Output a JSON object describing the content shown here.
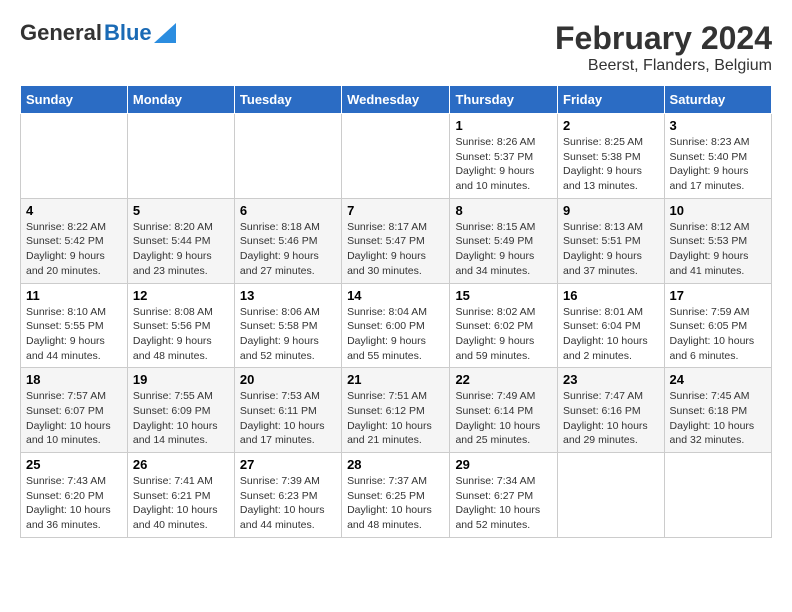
{
  "logo": {
    "part1": "General",
    "part2": "Blue"
  },
  "title": "February 2024",
  "subtitle": "Beerst, Flanders, Belgium",
  "days_of_week": [
    "Sunday",
    "Monday",
    "Tuesday",
    "Wednesday",
    "Thursday",
    "Friday",
    "Saturday"
  ],
  "weeks": [
    [
      {
        "day": "",
        "info": ""
      },
      {
        "day": "",
        "info": ""
      },
      {
        "day": "",
        "info": ""
      },
      {
        "day": "",
        "info": ""
      },
      {
        "day": "1",
        "info": "Sunrise: 8:26 AM\nSunset: 5:37 PM\nDaylight: 9 hours\nand 10 minutes."
      },
      {
        "day": "2",
        "info": "Sunrise: 8:25 AM\nSunset: 5:38 PM\nDaylight: 9 hours\nand 13 minutes."
      },
      {
        "day": "3",
        "info": "Sunrise: 8:23 AM\nSunset: 5:40 PM\nDaylight: 9 hours\nand 17 minutes."
      }
    ],
    [
      {
        "day": "4",
        "info": "Sunrise: 8:22 AM\nSunset: 5:42 PM\nDaylight: 9 hours\nand 20 minutes."
      },
      {
        "day": "5",
        "info": "Sunrise: 8:20 AM\nSunset: 5:44 PM\nDaylight: 9 hours\nand 23 minutes."
      },
      {
        "day": "6",
        "info": "Sunrise: 8:18 AM\nSunset: 5:46 PM\nDaylight: 9 hours\nand 27 minutes."
      },
      {
        "day": "7",
        "info": "Sunrise: 8:17 AM\nSunset: 5:47 PM\nDaylight: 9 hours\nand 30 minutes."
      },
      {
        "day": "8",
        "info": "Sunrise: 8:15 AM\nSunset: 5:49 PM\nDaylight: 9 hours\nand 34 minutes."
      },
      {
        "day": "9",
        "info": "Sunrise: 8:13 AM\nSunset: 5:51 PM\nDaylight: 9 hours\nand 37 minutes."
      },
      {
        "day": "10",
        "info": "Sunrise: 8:12 AM\nSunset: 5:53 PM\nDaylight: 9 hours\nand 41 minutes."
      }
    ],
    [
      {
        "day": "11",
        "info": "Sunrise: 8:10 AM\nSunset: 5:55 PM\nDaylight: 9 hours\nand 44 minutes."
      },
      {
        "day": "12",
        "info": "Sunrise: 8:08 AM\nSunset: 5:56 PM\nDaylight: 9 hours\nand 48 minutes."
      },
      {
        "day": "13",
        "info": "Sunrise: 8:06 AM\nSunset: 5:58 PM\nDaylight: 9 hours\nand 52 minutes."
      },
      {
        "day": "14",
        "info": "Sunrise: 8:04 AM\nSunset: 6:00 PM\nDaylight: 9 hours\nand 55 minutes."
      },
      {
        "day": "15",
        "info": "Sunrise: 8:02 AM\nSunset: 6:02 PM\nDaylight: 9 hours\nand 59 minutes."
      },
      {
        "day": "16",
        "info": "Sunrise: 8:01 AM\nSunset: 6:04 PM\nDaylight: 10 hours\nand 2 minutes."
      },
      {
        "day": "17",
        "info": "Sunrise: 7:59 AM\nSunset: 6:05 PM\nDaylight: 10 hours\nand 6 minutes."
      }
    ],
    [
      {
        "day": "18",
        "info": "Sunrise: 7:57 AM\nSunset: 6:07 PM\nDaylight: 10 hours\nand 10 minutes."
      },
      {
        "day": "19",
        "info": "Sunrise: 7:55 AM\nSunset: 6:09 PM\nDaylight: 10 hours\nand 14 minutes."
      },
      {
        "day": "20",
        "info": "Sunrise: 7:53 AM\nSunset: 6:11 PM\nDaylight: 10 hours\nand 17 minutes."
      },
      {
        "day": "21",
        "info": "Sunrise: 7:51 AM\nSunset: 6:12 PM\nDaylight: 10 hours\nand 21 minutes."
      },
      {
        "day": "22",
        "info": "Sunrise: 7:49 AM\nSunset: 6:14 PM\nDaylight: 10 hours\nand 25 minutes."
      },
      {
        "day": "23",
        "info": "Sunrise: 7:47 AM\nSunset: 6:16 PM\nDaylight: 10 hours\nand 29 minutes."
      },
      {
        "day": "24",
        "info": "Sunrise: 7:45 AM\nSunset: 6:18 PM\nDaylight: 10 hours\nand 32 minutes."
      }
    ],
    [
      {
        "day": "25",
        "info": "Sunrise: 7:43 AM\nSunset: 6:20 PM\nDaylight: 10 hours\nand 36 minutes."
      },
      {
        "day": "26",
        "info": "Sunrise: 7:41 AM\nSunset: 6:21 PM\nDaylight: 10 hours\nand 40 minutes."
      },
      {
        "day": "27",
        "info": "Sunrise: 7:39 AM\nSunset: 6:23 PM\nDaylight: 10 hours\nand 44 minutes."
      },
      {
        "day": "28",
        "info": "Sunrise: 7:37 AM\nSunset: 6:25 PM\nDaylight: 10 hours\nand 48 minutes."
      },
      {
        "day": "29",
        "info": "Sunrise: 7:34 AM\nSunset: 6:27 PM\nDaylight: 10 hours\nand 52 minutes."
      },
      {
        "day": "",
        "info": ""
      },
      {
        "day": "",
        "info": ""
      }
    ]
  ]
}
